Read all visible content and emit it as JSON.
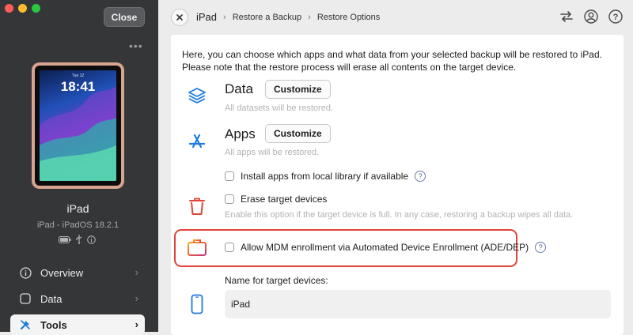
{
  "window": {
    "close_label": "Close",
    "more_icon": "ellipsis-icon"
  },
  "device": {
    "lock_time": "18:41",
    "lock_date": "Tue 12",
    "name": "iPad",
    "os_line": "iPad - iPadOS 18.2.1"
  },
  "sidebar": {
    "items": [
      {
        "label": "Overview",
        "icon": "info-circle-icon"
      },
      {
        "label": "Data",
        "icon": "square-icon"
      },
      {
        "label": "Tools",
        "icon": "tools-icon"
      }
    ]
  },
  "header": {
    "breadcrumbs": [
      "iPad",
      "Restore a Backup",
      "Restore Options"
    ],
    "separator": "›"
  },
  "content": {
    "intro": "Here, you can choose which apps and what data from your selected backup will be restored to iPad. Please note that the restore process will erase all contents on the target device.",
    "data_section": {
      "title": "Data",
      "button": "Customize",
      "subtitle": "All datasets will be restored."
    },
    "apps_section": {
      "title": "Apps",
      "button": "Customize",
      "subtitle": "All apps will be restored."
    },
    "install_local_label": "Install apps from local library if available",
    "erase_label": "Erase target devices",
    "erase_hint": "Enable this option if the target device is full. In any case, restoring a backup wipes all data.",
    "mdm_label": "Allow MDM enrollment via Automated Device Enrollment (ADE/DEP)",
    "name_label": "Name for target devices:",
    "name_value": "iPad",
    "help_glyph": "?"
  },
  "colors": {
    "accent_blue": "#1f7ae0",
    "erase_red": "#e0443b",
    "highlight_red": "#e0443b",
    "sidebar_bg": "#353638"
  }
}
